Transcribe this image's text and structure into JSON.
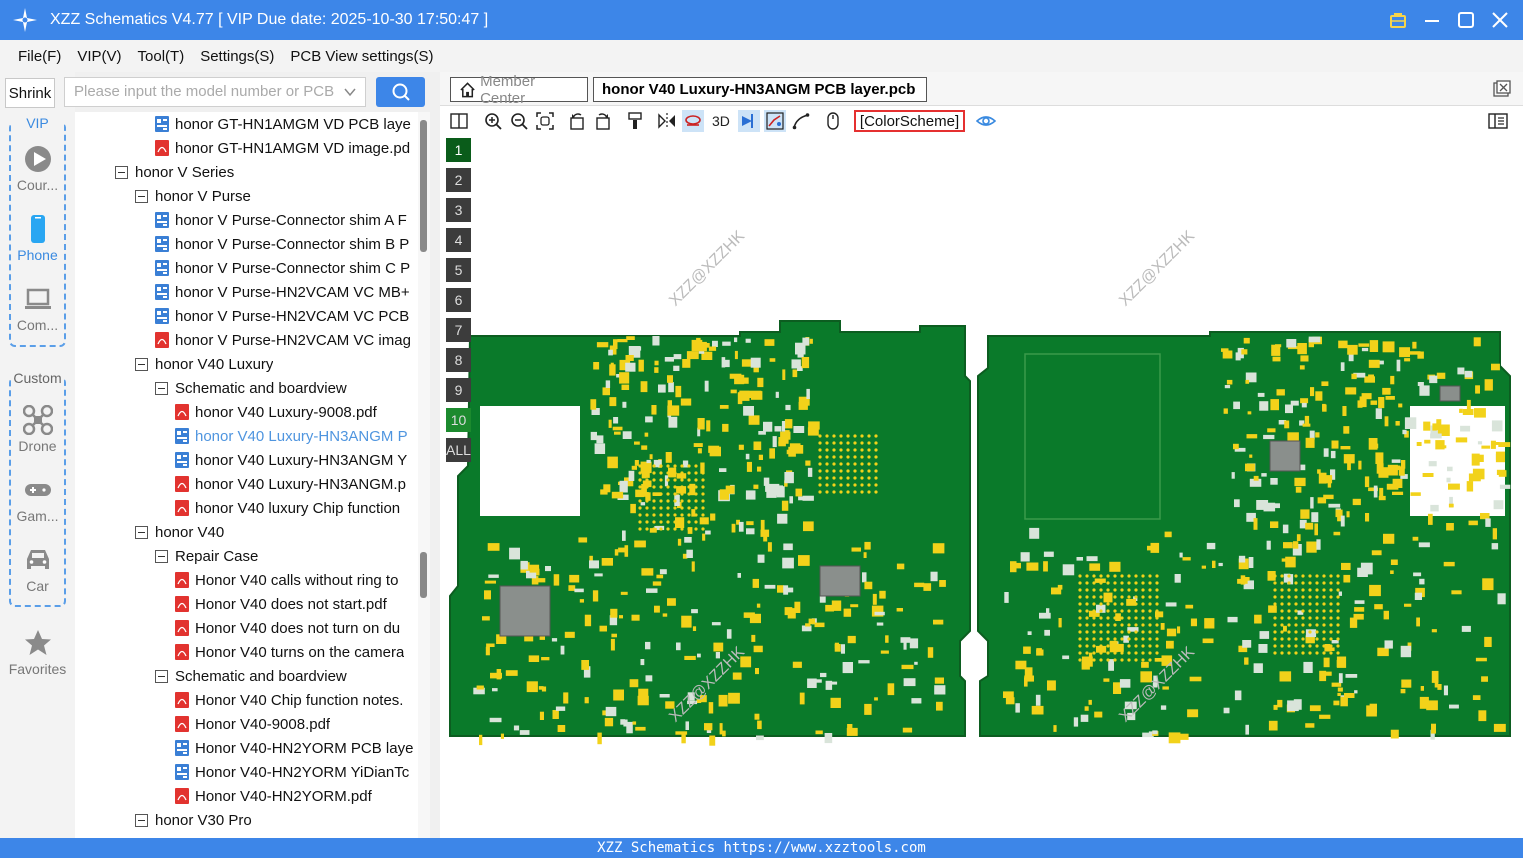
{
  "window": {
    "title": "XZZ Schematics V4.77 [ VIP Due date: 2025-10-30 17:50:47 ]"
  },
  "menu": [
    "File(F)",
    "VIP(V)",
    "Tool(T)",
    "Settings(S)",
    "PCB View settings(S)"
  ],
  "sidebar": {
    "shrink_label": "Shrink",
    "vip_group_title": "VIP",
    "vip_items": [
      "Cour...",
      "Phone",
      "Com..."
    ],
    "custom_group_title": "Custom",
    "custom_items": [
      "Drone",
      "Gam...",
      "Car"
    ],
    "favorites_label": "Favorites"
  },
  "search": {
    "placeholder": "Please input the model number or PCB"
  },
  "tree": [
    {
      "label": "honor GT-HN1AMGM VD PCB laye",
      "type": "pcb",
      "depth": 2
    },
    {
      "label": "honor GT-HN1AMGM VD image.pd",
      "type": "pdf",
      "depth": 2
    },
    {
      "label": "honor V Series",
      "type": "folder",
      "depth": 0
    },
    {
      "label": "honor V Purse",
      "type": "folder",
      "depth": 1
    },
    {
      "label": "honor V Purse-Connector shim A F",
      "type": "pcb",
      "depth": 2
    },
    {
      "label": "honor V Purse-Connector shim B P",
      "type": "pcb",
      "depth": 2
    },
    {
      "label": "honor V Purse-Connector shim C P",
      "type": "pcb",
      "depth": 2
    },
    {
      "label": "honor V Purse-HN2VCAM VC MB+",
      "type": "pcb",
      "depth": 2
    },
    {
      "label": "honor V Purse-HN2VCAM VC PCB",
      "type": "pcb",
      "depth": 2
    },
    {
      "label": "honor V Purse-HN2VCAM VC imag",
      "type": "pdf",
      "depth": 2
    },
    {
      "label": "honor V40 Luxury",
      "type": "folder",
      "depth": 1
    },
    {
      "label": "Schematic and boardview",
      "type": "folder",
      "depth": 2
    },
    {
      "label": "honor V40 Luxury-9008.pdf",
      "type": "pdf",
      "depth": 3
    },
    {
      "label": "honor V40 Luxury-HN3ANGM P",
      "type": "pcb",
      "depth": 3,
      "selected": true
    },
    {
      "label": "honor V40 Luxury-HN3ANGM Y",
      "type": "pcb",
      "depth": 3
    },
    {
      "label": "honor V40 Luxury-HN3ANGM.p",
      "type": "pdf",
      "depth": 3
    },
    {
      "label": "honor V40 luxury Chip function",
      "type": "pdf",
      "depth": 3
    },
    {
      "label": "honor V40",
      "type": "folder",
      "depth": 1
    },
    {
      "label": "Repair Case",
      "type": "folder",
      "depth": 2
    },
    {
      "label": "Honor V40 calls without ring to",
      "type": "pdf",
      "depth": 3
    },
    {
      "label": "Honor V40 does not start.pdf",
      "type": "pdf",
      "depth": 3
    },
    {
      "label": "Honor V40 does not turn on du",
      "type": "pdf",
      "depth": 3
    },
    {
      "label": "Honor V40 turns on the camera",
      "type": "pdf",
      "depth": 3
    },
    {
      "label": "Schematic and boardview",
      "type": "folder",
      "depth": 2
    },
    {
      "label": "Honor V40 Chip function notes.",
      "type": "pdf",
      "depth": 3
    },
    {
      "label": "Honor V40-9008.pdf",
      "type": "pdf",
      "depth": 3
    },
    {
      "label": "Honor V40-HN2YORM PCB laye",
      "type": "pcb",
      "depth": 3
    },
    {
      "label": "Honor V40-HN2YORM YiDianTc",
      "type": "pcb",
      "depth": 3
    },
    {
      "label": "Honor V40-HN2YORM.pdf",
      "type": "pdf",
      "depth": 3
    },
    {
      "label": "honor V30 Pro",
      "type": "folder",
      "depth": 1
    }
  ],
  "tabs": {
    "home_label": "Member Center",
    "active_label": "honor V40 Luxury-HN3ANGM PCB layer.pcb"
  },
  "toolbar": {
    "three_d_label": "3D",
    "color_scheme_label": "[ColorScheme]"
  },
  "layers": [
    "1",
    "2",
    "3",
    "4",
    "5",
    "6",
    "7",
    "8",
    "9",
    "10",
    "ALL"
  ],
  "watermark": "XZZ@XZZHK",
  "statusbar": {
    "text": "XZZ Schematics https://www.xzztools.com"
  },
  "colors": {
    "accent": "#3d86e8",
    "pcb_green": "#0a7a2a",
    "pad_yellow": "#f2d21a",
    "color_scheme_border": "#e53030"
  }
}
